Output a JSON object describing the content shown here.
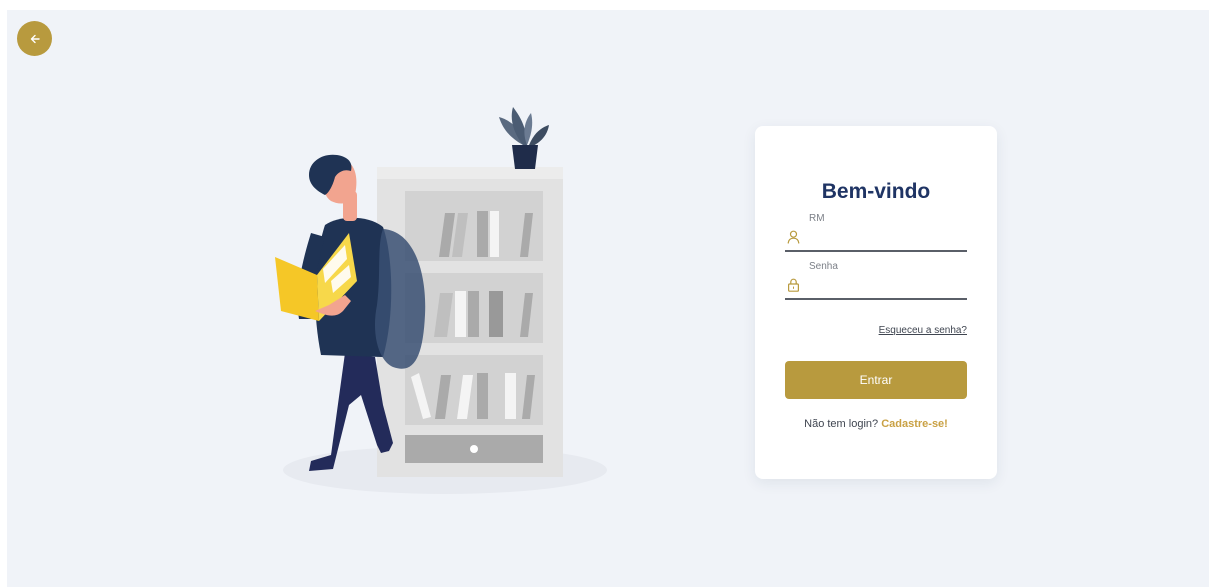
{
  "colors": {
    "accent": "#b89a3e",
    "title": "#1f3464",
    "background": "#f0f3f8",
    "card": "#ffffff",
    "link": "#c9a144"
  },
  "back_button": {
    "icon": "arrow-left-icon"
  },
  "illustration": {
    "description_icon": "person-reading-at-bookshelf-illustration"
  },
  "login": {
    "title": "Bem-vindo",
    "rm": {
      "label": "RM",
      "value": "",
      "placeholder": "",
      "icon": "user-icon"
    },
    "password": {
      "label": "Senha",
      "value": "",
      "placeholder": "",
      "icon": "lock-icon"
    },
    "forgot_label": "Esqueceu a senha?",
    "submit_label": "Entrar",
    "signup_prompt": "Não tem login?",
    "signup_link": "Cadastre-se!"
  }
}
